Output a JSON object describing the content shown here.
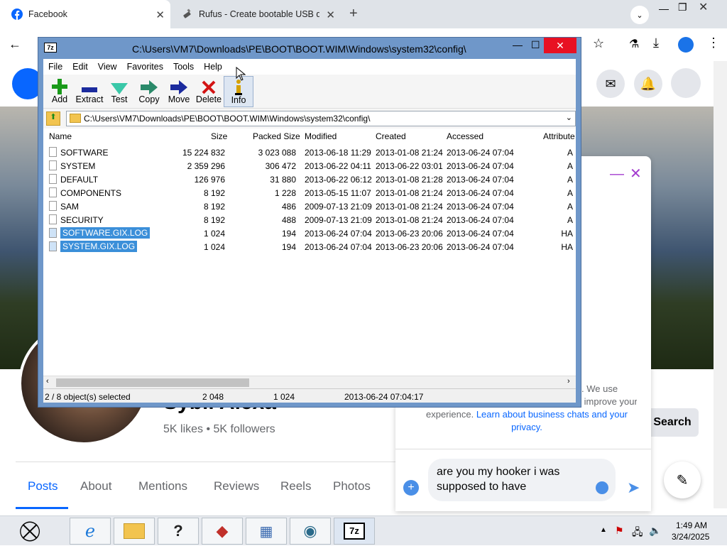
{
  "browser": {
    "tabs": [
      {
        "label": "Facebook"
      },
      {
        "label": "Rufus - Create bootable USB di"
      }
    ]
  },
  "facebook": {
    "nav": [
      "Posts",
      "About",
      "Mentions",
      "Reviews",
      "Reels",
      "Photos"
    ],
    "profile_name": "Sybil Alexa",
    "stats": "5K likes • 5K followers",
    "search_label": "Search",
    "chat": {
      "notice_partial": ". We use",
      "notice_line2": "ookies to improve your",
      "notice_line3_pre": "experience. ",
      "notice_link": "Learn about business chats and your privacy.",
      "message": "are you my hooker i was supposed to have"
    }
  },
  "sevenzip": {
    "title": "C:\\Users\\VM7\\Downloads\\PE\\BOOT\\BOOT.WIM\\Windows\\system32\\config\\",
    "address": "C:\\Users\\VM7\\Downloads\\PE\\BOOT\\BOOT.WIM\\Windows\\system32\\config\\",
    "menu": [
      "File",
      "Edit",
      "View",
      "Favorites",
      "Tools",
      "Help"
    ],
    "toolbar": [
      "Add",
      "Extract",
      "Test",
      "Copy",
      "Move",
      "Delete",
      "Info"
    ],
    "columns": [
      "Name",
      "Size",
      "Packed Size",
      "Modified",
      "Created",
      "Accessed",
      "Attribute"
    ],
    "rows": [
      {
        "name": "SOFTWARE",
        "size": "15 224 832",
        "packed": "3 023 088",
        "modified": "2013-06-18 11:29",
        "created": "2013-01-08 21:24",
        "accessed": "2013-06-24 07:04",
        "attr": "A"
      },
      {
        "name": "SYSTEM",
        "size": "2 359 296",
        "packed": "306 472",
        "modified": "2013-06-22 04:11",
        "created": "2013-06-22 03:01",
        "accessed": "2013-06-24 07:04",
        "attr": "A"
      },
      {
        "name": "DEFAULT",
        "size": "126 976",
        "packed": "31 880",
        "modified": "2013-06-22 06:12",
        "created": "2013-01-08 21:28",
        "accessed": "2013-06-24 07:04",
        "attr": "A"
      },
      {
        "name": "COMPONENTS",
        "size": "8 192",
        "packed": "1 228",
        "modified": "2013-05-15 11:07",
        "created": "2013-01-08 21:24",
        "accessed": "2013-06-24 07:04",
        "attr": "A"
      },
      {
        "name": "SAM",
        "size": "8 192",
        "packed": "486",
        "modified": "2009-07-13 21:09",
        "created": "2013-01-08 21:24",
        "accessed": "2013-06-24 07:04",
        "attr": "A"
      },
      {
        "name": "SECURITY",
        "size": "8 192",
        "packed": "488",
        "modified": "2009-07-13 21:09",
        "created": "2013-01-08 21:24",
        "accessed": "2013-06-24 07:04",
        "attr": "A"
      },
      {
        "name": "SOFTWARE.GIX.LOG",
        "size": "1 024",
        "packed": "194",
        "modified": "2013-06-24 07:04",
        "created": "2013-06-23 20:06",
        "accessed": "2013-06-24 07:04",
        "attr": "HA"
      },
      {
        "name": "SYSTEM.GIX.LOG",
        "size": "1 024",
        "packed": "194",
        "modified": "2013-06-24 07:04",
        "created": "2013-06-23 20:06",
        "accessed": "2013-06-24 07:04",
        "attr": "HA"
      }
    ],
    "status": {
      "selected": "2 / 8 object(s) selected",
      "size": "2 048",
      "packed": "1 024",
      "date": "2013-06-24 07:04:17"
    }
  },
  "taskbar": {
    "time": "1:49 AM",
    "date": "3/24/2025"
  },
  "colors": {
    "fb_blue": "#0866ff",
    "selection": "#3b8fd9",
    "sevenzip_frame": "#6f97c9",
    "close_red": "#e81123"
  }
}
